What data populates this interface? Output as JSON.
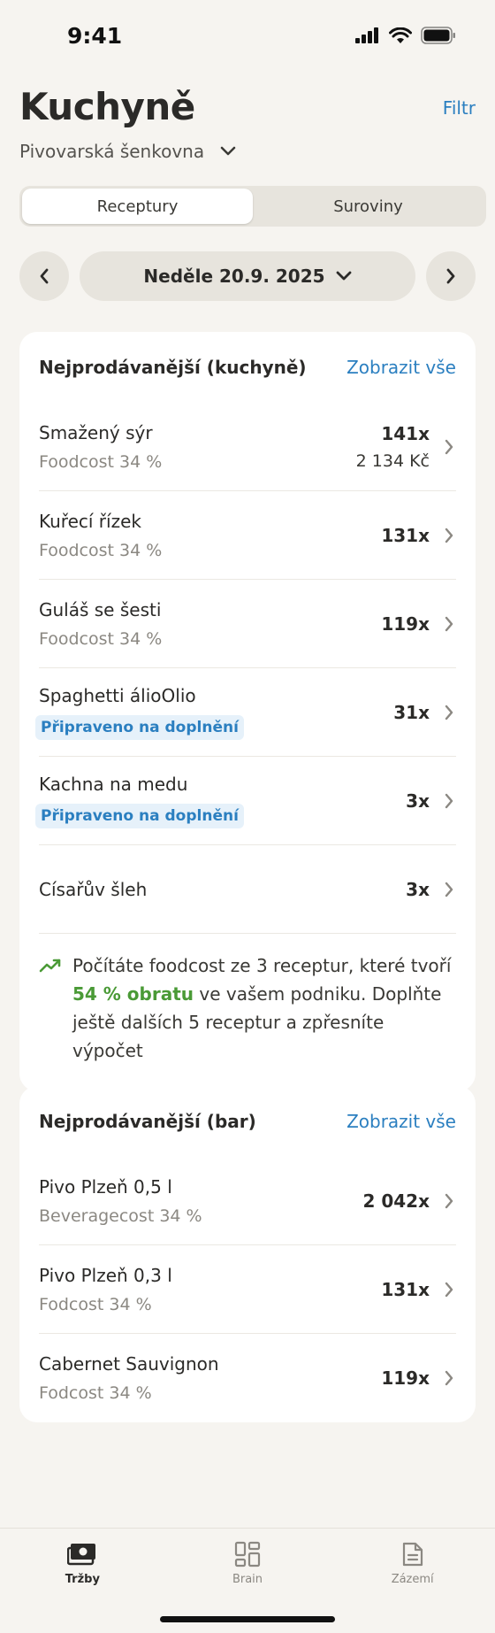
{
  "status": {
    "time": "9:41"
  },
  "header": {
    "title": "Kuchyně",
    "filter_label": "Filtr",
    "venue": "Pivovarská šenkovna"
  },
  "segments": [
    {
      "label": "Receptury",
      "active": true
    },
    {
      "label": "Suroviny",
      "active": false
    }
  ],
  "date": {
    "label": "Neděle 20.9. 2025"
  },
  "kitchen": {
    "title": "Nejprodávanější (kuchyně)",
    "link": "Zobrazit vše",
    "items": [
      {
        "name": "Smažený sýr",
        "sub": "Foodcost 34 %",
        "count": "141x",
        "amount": "2 134 Kč"
      },
      {
        "name": "Kuřecí řízek",
        "sub": "Foodcost 34 %",
        "count": "131x"
      },
      {
        "name": "Guláš se šesti",
        "sub": "Foodcost 34 %",
        "count": "119x"
      },
      {
        "name": "Spaghetti álioOlio",
        "badge": "Připraveno na doplnění",
        "count": "31x"
      },
      {
        "name": "Kachna na medu",
        "badge": "Připraveno na doplnění",
        "count": "3x"
      },
      {
        "name": "Císařův šleh",
        "count": "3x"
      }
    ],
    "info": {
      "line1": "Počítáte foodcost ze 3 receptur, které tvoří",
      "highlight": "54 % obratu",
      "line2": " ve vašem podniku. Doplňte ještě dalších 5 receptur a zpřesníte výpočet"
    }
  },
  "bar": {
    "title": "Nejprodávanější (bar)",
    "link": "Zobrazit vše",
    "items": [
      {
        "name": "Pivo Plzeň 0,5 l",
        "sub": "Beveragecost 34 %",
        "count": "2 042x"
      },
      {
        "name": "Pivo Plzeň 0,3 l",
        "sub": "Fodcost 34 %",
        "count": "131x"
      },
      {
        "name": "Cabernet Sauvignon",
        "sub": "Fodcost 34 %",
        "count": "119x"
      }
    ]
  },
  "tabs": [
    {
      "label": "Tržby",
      "icon": "cash-icon",
      "active": true
    },
    {
      "label": "Brain",
      "icon": "grid-icon",
      "active": false
    },
    {
      "label": "Zázemí",
      "icon": "document-icon",
      "active": false
    }
  ],
  "colors": {
    "accent": "#2b7fc0",
    "positive": "#4a9a36",
    "background": "#f6f4f0"
  }
}
